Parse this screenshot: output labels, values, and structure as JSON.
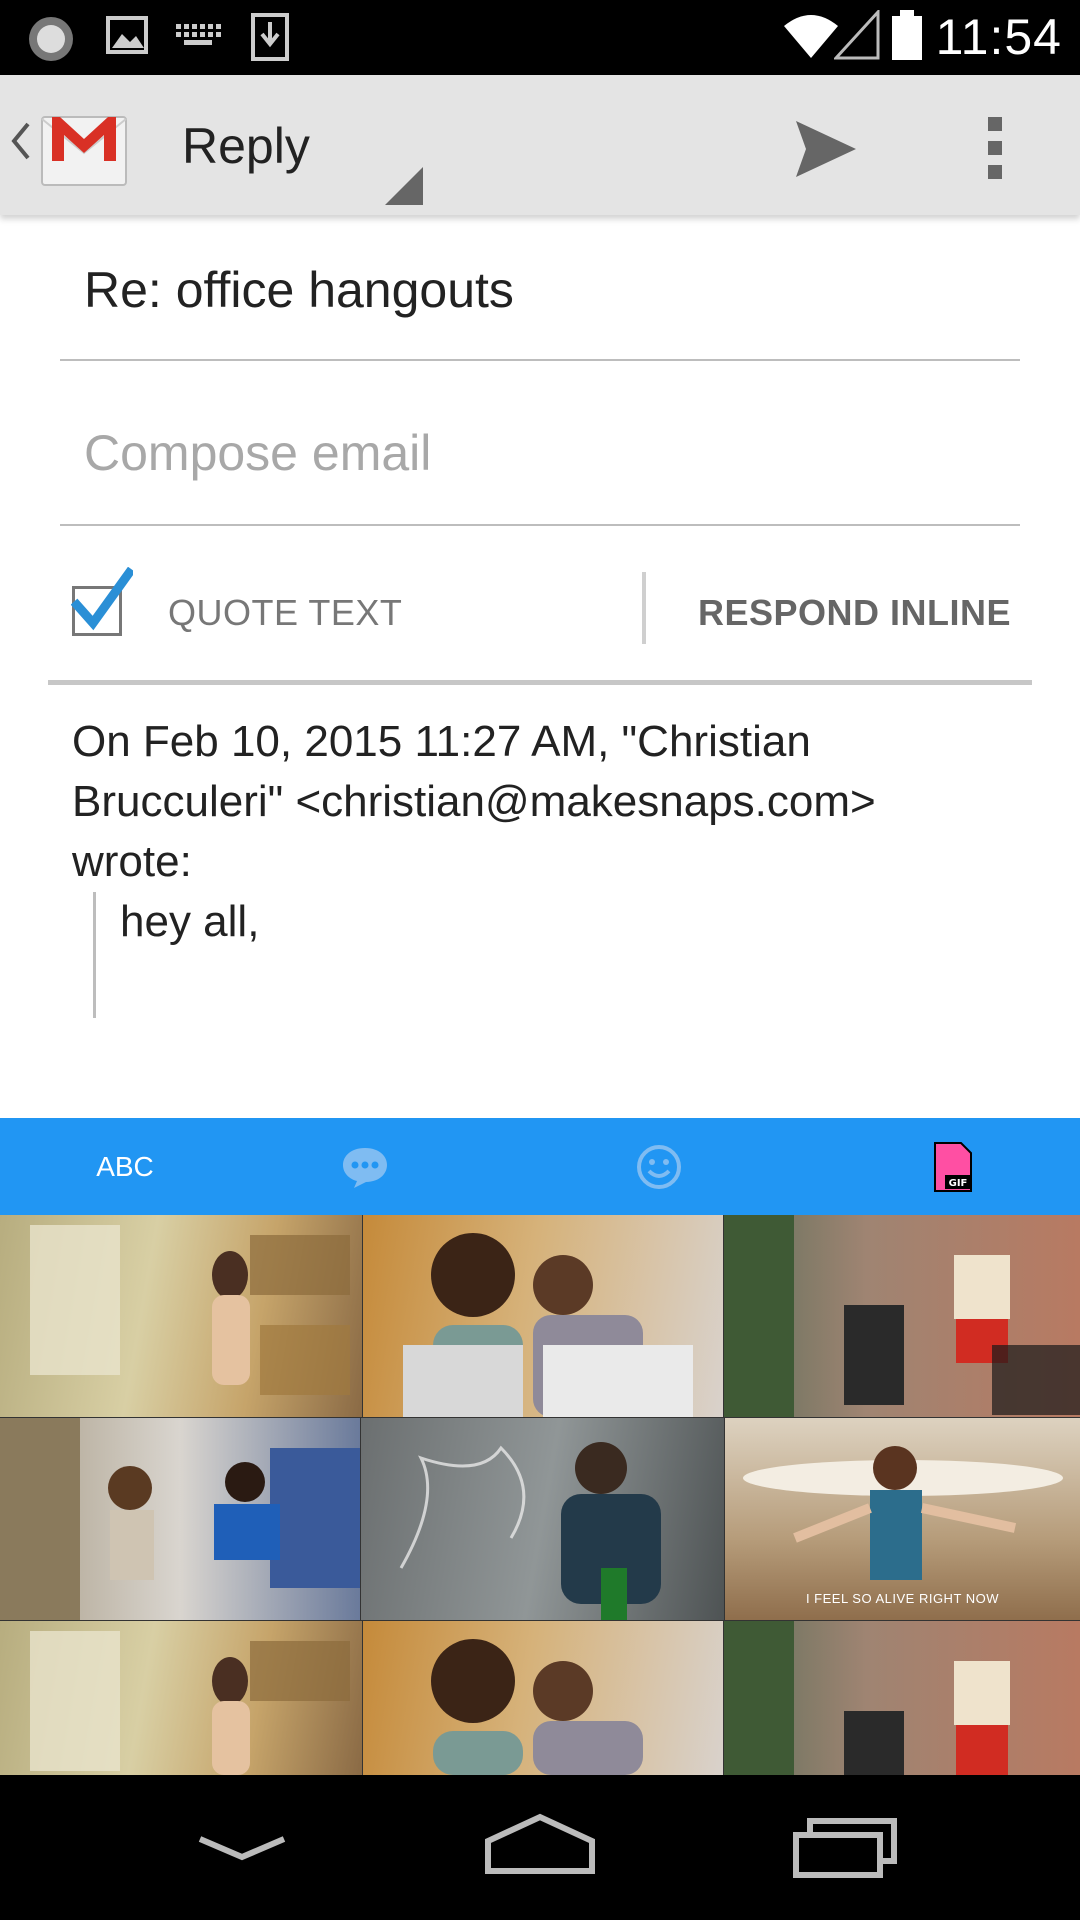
{
  "status_bar": {
    "time": "11:54",
    "left_icons": [
      "record-icon",
      "image-icon",
      "keyboard-icon",
      "download-icon"
    ],
    "right_icons": [
      "wifi-icon",
      "signal-icon",
      "battery-icon"
    ]
  },
  "action_bar": {
    "app_icon": "gmail-icon",
    "title": "Reply",
    "send_icon": "send-icon",
    "overflow_icon": "overflow-menu-icon"
  },
  "compose": {
    "subject": "Re: office hangouts",
    "body_placeholder": "Compose email",
    "body_value": ""
  },
  "quote_options": {
    "quote_text_label": "QUOTE TEXT",
    "quote_text_checked": true,
    "respond_inline_label": "RESPOND INLINE"
  },
  "quoted": {
    "header_line1": "On Feb 10, 2015 11:27 AM, \"Christian",
    "header_line2": "Brucculeri\" <christian@makesnaps.com>",
    "header_line3": "wrote:",
    "body": "hey all,"
  },
  "keyboard": {
    "tabs": [
      {
        "label": "ABC",
        "icon": null
      },
      {
        "label": "",
        "icon": "chat-bubble-icon"
      },
      {
        "label": "",
        "icon": "smiley-icon"
      },
      {
        "label": "",
        "icon": "gif-file-icon"
      }
    ],
    "accent_color": "#2196f3",
    "gif_caption": "I FEEL SO ALIVE RIGHT NOW"
  },
  "nav_bar": {
    "buttons": [
      "back-chevron-down-icon",
      "home-icon",
      "recents-icon"
    ]
  }
}
